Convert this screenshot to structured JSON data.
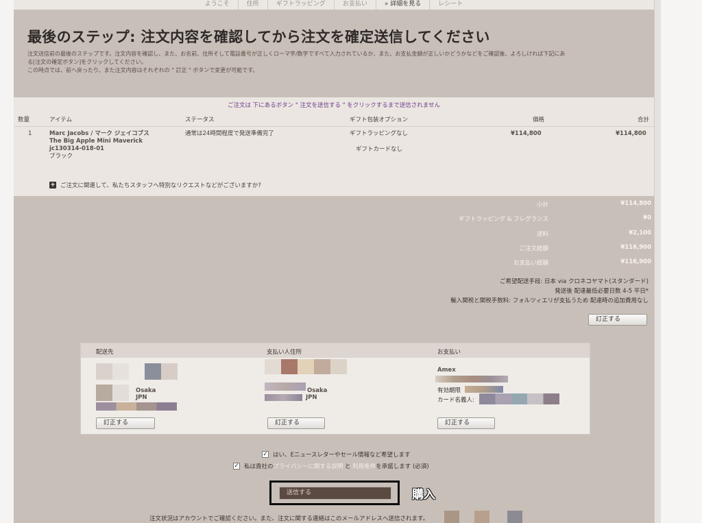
{
  "steps": [
    "ようこそ",
    "住所",
    "ギフトラッピング",
    "お支払い",
    "» 詳細を見る",
    "レシート"
  ],
  "headline": "最後のステップ: 注文内容を確認してから注文を確定送信してください",
  "intro": {
    "line1": "注文送信前の最後のステップです。注文内容を確認し、また、お名前、住所そして電話番号が正しくローマ字/数字ですべて入力されているか、また、お支払金額が正しいかどうかなどをご確認後、よろしければ下記にあ",
    "line2": "る[注文の確定ボタン]をクリックしてください。",
    "line3": "この時点では、前へ戻ったり、また注文内容はそれぞれの \" 訂正 \" ボタンで変更が可能です。"
  },
  "notice": "ご注文は 下にあるボタン \" 注文を送信する \" をクリックするまで送信されません",
  "table": {
    "headers": {
      "qty": "数量",
      "item": "アイテム",
      "status": "ステータス",
      "gift": "ギフト包装オプション",
      "price": "価格",
      "total": "合計"
    },
    "row": {
      "qty": "1",
      "brand": "Marc Jacobs / マーク ジェイコブス",
      "name": "The Big Apple Mini Maverick",
      "sku": "jc130314-018-01",
      "color": "ブラック",
      "status": "通常は24時間程度で発送準備完了",
      "gift1": "ギフトラッピングなし",
      "gift2": "ギフトカードなし",
      "price": "¥114,800",
      "total": "¥114,800"
    },
    "request": "ご注文に関連して、私たちスタッフへ特別なリクエストなどがございますか?"
  },
  "totals": [
    {
      "label": "小計",
      "value": "¥114,800"
    },
    {
      "label": "ギフトラッピング & フレグランス",
      "value": "¥0"
    },
    {
      "label": "送料",
      "value": "¥2,100"
    },
    {
      "label": "ご注文総額",
      "value": "¥116,900"
    },
    {
      "label": "お支払い総額",
      "value": "¥116,900"
    }
  ],
  "shipping": {
    "method": "ご希望配送手段: 日本 via クロネコヤマト(スタンダード)",
    "days": "発送後 配達最低必要日数 4-5 平日*",
    "duty": "輸入関税と関税手数料: フォルツィエリが支払うため 配達時の追加費用なし",
    "edit": "訂正する"
  },
  "address": {
    "ship_title": "配送先",
    "bill_title": "支払い人住所",
    "pay_title": "お支払い",
    "ship_city": "Osaka",
    "ship_country": "JPN",
    "bill_city": "Osaka",
    "bill_country": "JPN",
    "card": "Amex",
    "expiry": "有効期限",
    "holder": "カード名義人:",
    "edit": "訂正する"
  },
  "checks": {
    "newsletter": "はい、Eニュースレターやセール情報など希望します",
    "privacy_pre": "私は貴社の",
    "privacy_link": "プライバシーに関する説明",
    "privacy_and": " と ",
    "terms_link": "利用条件",
    "privacy_post": "を承諾します (必須)"
  },
  "submit": "送信する",
  "purchase_label": "購入",
  "footer": "注文状況はアカウントでご確認ください。また、注文に関する連絡はこのメールアドレスへ送信されます。",
  "colors": {
    "link": "#6b3a8c",
    "panel": "#c8bfb8",
    "submit": "#5b4a42"
  }
}
